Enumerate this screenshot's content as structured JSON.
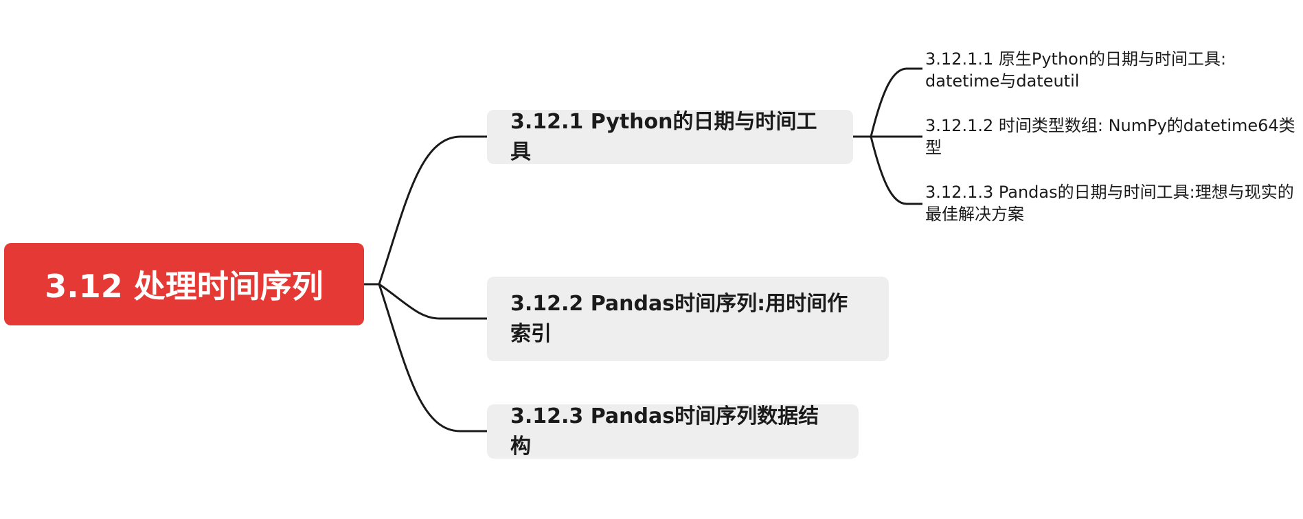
{
  "mindmap": {
    "root": {
      "label": "3.12 处理时间序列"
    },
    "topics": [
      {
        "label": "3.12.1 Python的日期与时间工具",
        "subtopics": [
          {
            "label": "3.12.1.1 原生Python的日期与时间工具: datetime与dateutil"
          },
          {
            "label": "3.12.1.2 时间类型数组: NumPy的datetime64类型"
          },
          {
            "label": "3.12.1.3 Pandas的日期与时间工具:理想与现实的最佳解决方案"
          }
        ]
      },
      {
        "label": "3.12.2 Pandas时间序列:用时间作索引"
      },
      {
        "label": "3.12.3 Pandas时间序列数据结构"
      }
    ]
  },
  "colors": {
    "root_bg": "#e53935",
    "topic_bg": "#eeeeee",
    "connector": "#1a1a1a"
  }
}
